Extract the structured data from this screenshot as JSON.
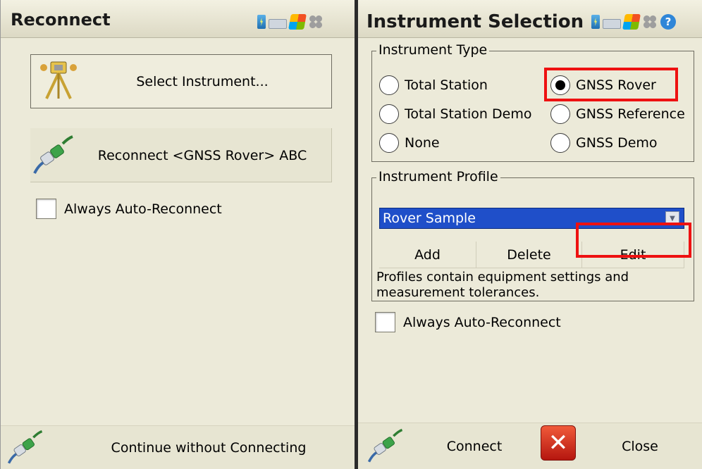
{
  "left_screen": {
    "title": "Reconnect",
    "select_instrument_label": "Select Instrument...",
    "reconnect_label": "Reconnect <GNSS Rover> ABC",
    "always_auto_reconnect_label": "Always Auto-Reconnect",
    "always_auto_reconnect_checked": false,
    "continue_label": "Continue without Connecting"
  },
  "right_screen": {
    "title": "Instrument Selection",
    "instrument_type": {
      "legend": "Instrument Type",
      "options": [
        {
          "label": "Total Station",
          "checked": false
        },
        {
          "label": "GNSS Rover",
          "checked": true
        },
        {
          "label": "Total Station Demo",
          "checked": false
        },
        {
          "label": "GNSS Reference",
          "checked": false
        },
        {
          "label": "None",
          "checked": false
        },
        {
          "label": "GNSS Demo",
          "checked": false
        }
      ]
    },
    "instrument_profile": {
      "legend": "Instrument Profile",
      "selected_profile": "Rover Sample",
      "add_label": "Add",
      "delete_label": "Delete",
      "edit_label": "Edit",
      "description": "Profiles contain equipment settings and measurement tolerances."
    },
    "always_auto_reconnect_label": "Always Auto-Reconnect",
    "always_auto_reconnect_checked": false,
    "connect_label": "Connect",
    "close_label": "Close"
  },
  "colors": {
    "highlight": "#ee1111",
    "dropdown_selected": "#1f4fc9",
    "background": "#ecead9"
  },
  "icons": {
    "tray": [
      "battery-icon",
      "keyboard-icon",
      "windows-start-icon",
      "network-icon",
      "help-icon"
    ],
    "select_instrument": "tripod-instrument-icon",
    "reconnect": "plug-connector-icon",
    "close": "red-x-icon"
  }
}
